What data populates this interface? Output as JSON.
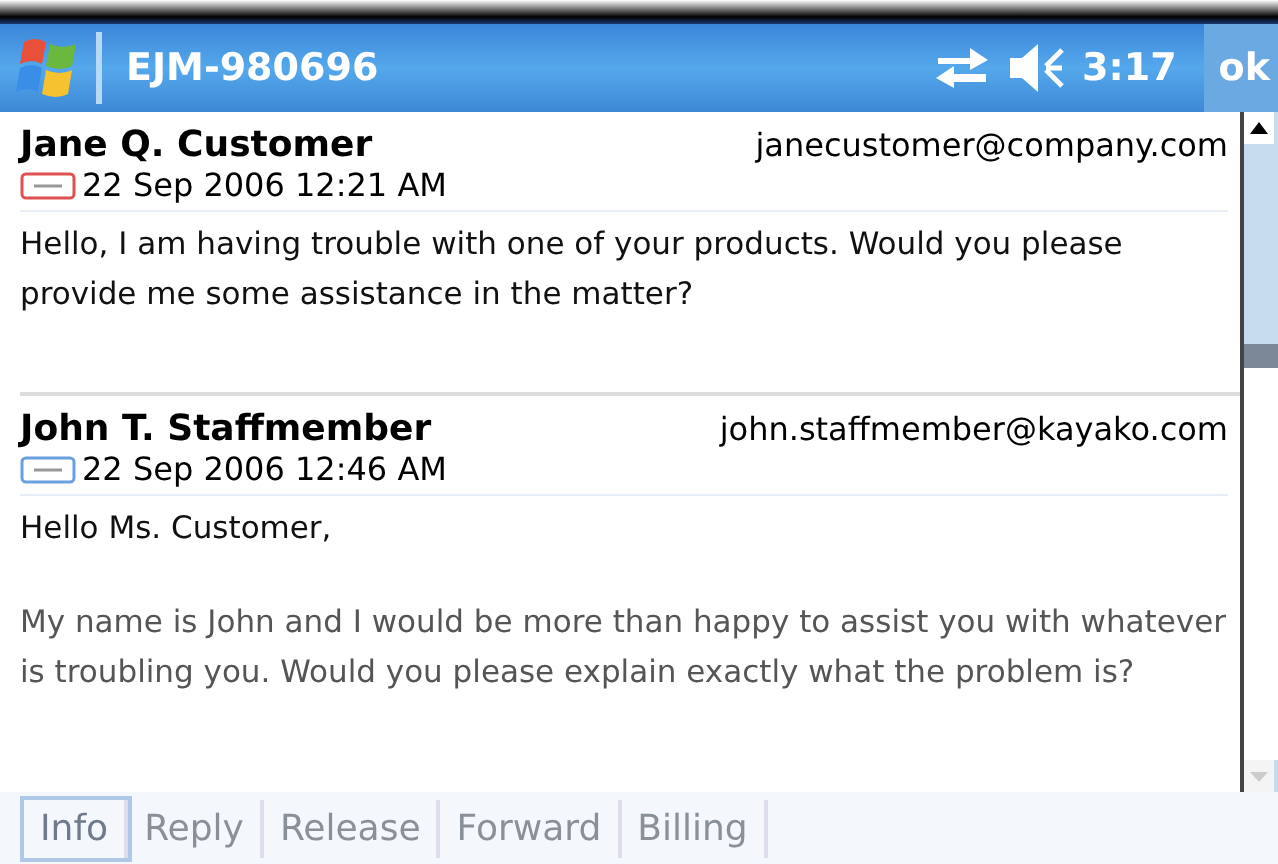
{
  "title_bar": {
    "title": "EJM-980696",
    "time": "3:17",
    "ok": "ok"
  },
  "messages": [
    {
      "name": "Jane Q. Customer",
      "email": "janecustomer@company.com",
      "kind": "user",
      "date": "22 Sep 2006 12:21 AM",
      "paragraphs": [
        "Hello, I am having trouble with one of your products.  Would you please provide me some assistance in the matter?"
      ]
    },
    {
      "name": "John T. Staffmember",
      "email": "john.staffmember@kayako.com",
      "kind": "staff",
      "date": "22 Sep 2006 12:46 AM",
      "paragraphs": [
        "Hello Ms. Customer,",
        "My name is John and I would be more than happy to assist you with whatever is troubling you.  Would you please explain exactly what the problem is?"
      ]
    }
  ],
  "tabs": [
    {
      "label": "Info",
      "selected": true
    },
    {
      "label": "Reply",
      "selected": false
    },
    {
      "label": "Release",
      "selected": false
    },
    {
      "label": "Forward",
      "selected": false
    },
    {
      "label": "Billing",
      "selected": false
    }
  ]
}
